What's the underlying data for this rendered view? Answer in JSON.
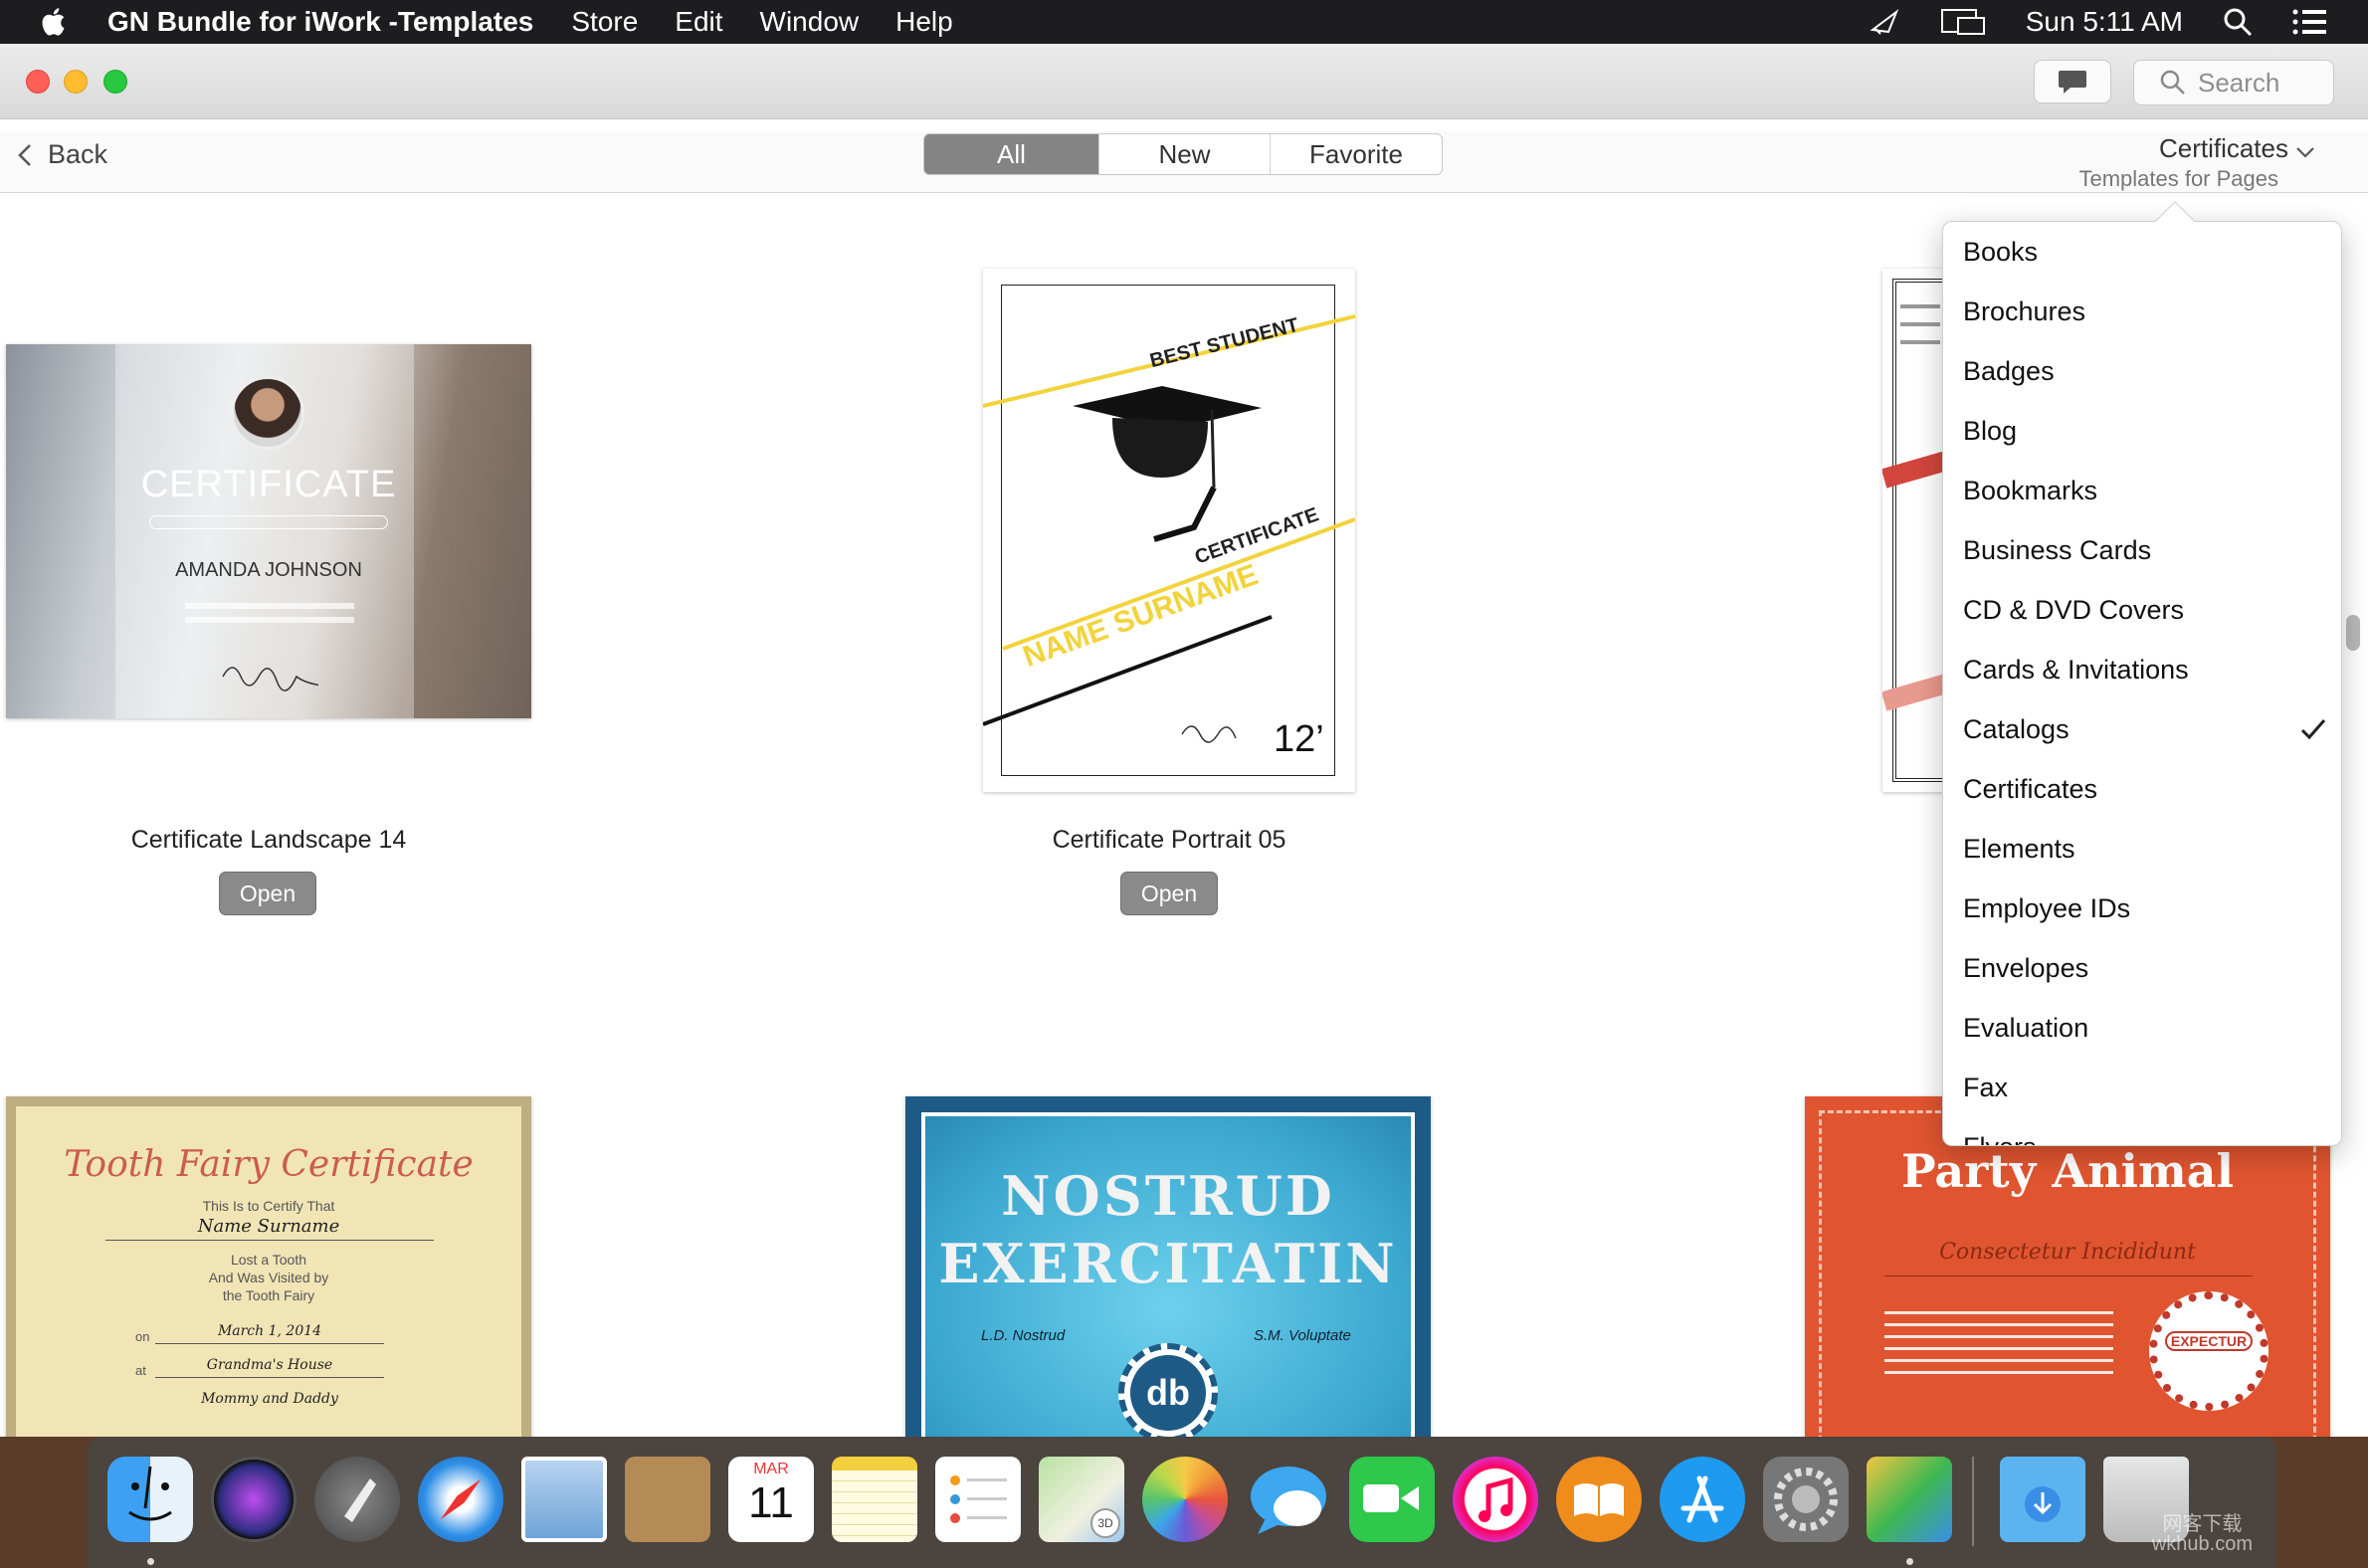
{
  "menubar": {
    "app_name": "GN Bundle for iWork -Templates",
    "menus": [
      "Store",
      "Edit",
      "Window",
      "Help"
    ],
    "clock": "Sun 5:11 AM"
  },
  "window": {
    "search_placeholder": "Search"
  },
  "toolbar": {
    "back_label": "Back",
    "segments": [
      "All",
      "New",
      "Favorite"
    ],
    "active_segment": "All",
    "category_title": "Certificates",
    "category_subtitle": "Templates for Pages"
  },
  "templates": [
    {
      "title": "Certificate Landscape 14",
      "open_label": "Open",
      "thumb_text": {
        "heading": "CERTIFICATE",
        "name": "AMANDA JOHNSON"
      }
    },
    {
      "title": "Certificate Portrait 05",
      "open_label": "Open",
      "thumb_text": {
        "top": "BEST STUDENT",
        "middle": "CERTIFICATE",
        "name": "NAME SURNAME",
        "year": "12’"
      }
    },
    {
      "title": "",
      "open_label": ""
    },
    {
      "title": "",
      "open_label": "",
      "thumb_text": {
        "heading": "Tooth Fairy Certificate",
        "line1": "This Is to Certify That",
        "name": "Name Surname",
        "line2": "Lost a Tooth",
        "line3": "And Was Visited by",
        "line4": "the Tooth Fairy",
        "on_label": "on",
        "date": "March 1, 2014",
        "at_label": "at",
        "place": "Grandma's House",
        "signers": "Mommy and Daddy"
      }
    },
    {
      "title": "",
      "open_label": "",
      "thumb_text": {
        "line1": "NOSTRUD",
        "line2": "EXERCITATIN",
        "sig_left": "L.D. Nostrud",
        "sig_right": "S.M. Voluptate",
        "seal": "db"
      }
    },
    {
      "title": "",
      "open_label": "",
      "thumb_text": {
        "heading": "Party Animal",
        "sub": "Consectetur Incididunt",
        "seal": "EXPECTUR"
      }
    }
  ],
  "dropdown": {
    "items": [
      "Books",
      "Brochures",
      "Badges",
      "Blog",
      "Bookmarks",
      "Business Cards",
      "CD & DVD Covers",
      "Cards & Invitations",
      "Catalogs",
      "Certificates",
      "Elements",
      "Employee IDs",
      "Envelopes",
      "Evaluation",
      "Fax",
      "Flyers"
    ],
    "checked": "Catalogs"
  },
  "dock": {
    "apps": [
      "finder-icon",
      "siri-icon",
      "launchpad-icon",
      "safari-icon",
      "mail-icon",
      "contacts-icon",
      "calendar-icon",
      "notes-icon",
      "reminders-icon",
      "maps-icon",
      "photos-icon",
      "messages-icon",
      "facetime-icon",
      "itunes-icon",
      "ibooks-icon",
      "app-store-icon",
      "system-preferences-icon",
      "gn-bundle-icon",
      "downloads-icon",
      "trash-icon"
    ],
    "calendar_month": "MAR",
    "calendar_day": "11",
    "maps_badge": "3D"
  },
  "watermark": {
    "line1": "网客下载",
    "line2": "wkhub.com"
  },
  "colors": {
    "menubar": "#1d1d1f",
    "traffic_red": "#ff5f57",
    "traffic_yellow": "#febc2e",
    "traffic_green": "#28c840",
    "segment_active": "#848484",
    "open_button": "#8a8a8a"
  }
}
